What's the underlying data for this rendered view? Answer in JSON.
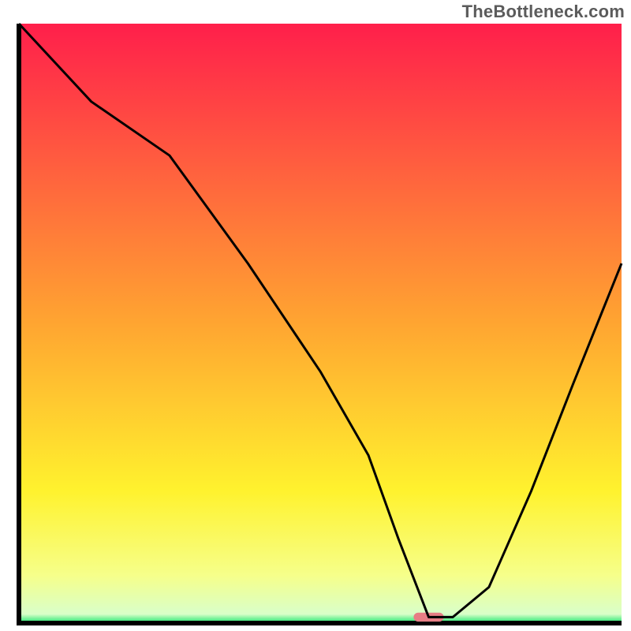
{
  "watermark": "TheBottleneck.com",
  "chart_data": {
    "type": "line",
    "title": "",
    "xlabel": "",
    "ylabel": "",
    "xlim": [
      0,
      100
    ],
    "ylim": [
      0,
      100
    ],
    "background": {
      "gradient_stops": [
        {
          "offset": 0.0,
          "color": "#ff1f4b"
        },
        {
          "offset": 0.5,
          "color": "#ffa531"
        },
        {
          "offset": 0.78,
          "color": "#fff22e"
        },
        {
          "offset": 0.92,
          "color": "#f6ff8a"
        },
        {
          "offset": 0.985,
          "color": "#d9ffc9"
        },
        {
          "offset": 1.0,
          "color": "#17e36a"
        }
      ]
    },
    "series": [
      {
        "name": "bottleneck-curve",
        "color": "#000000",
        "x": [
          0,
          12,
          25,
          38,
          50,
          58,
          63,
          68,
          72,
          78,
          85,
          92,
          100
        ],
        "y": [
          100,
          87,
          78,
          60,
          42,
          28,
          14,
          1,
          1,
          6,
          22,
          40,
          60
        ]
      }
    ],
    "marker": {
      "name": "optimal-marker",
      "x": 68,
      "y": 1,
      "color": "#e77e85",
      "width_frac": 0.05,
      "height_frac": 0.015
    },
    "frame_color": "#000000"
  }
}
